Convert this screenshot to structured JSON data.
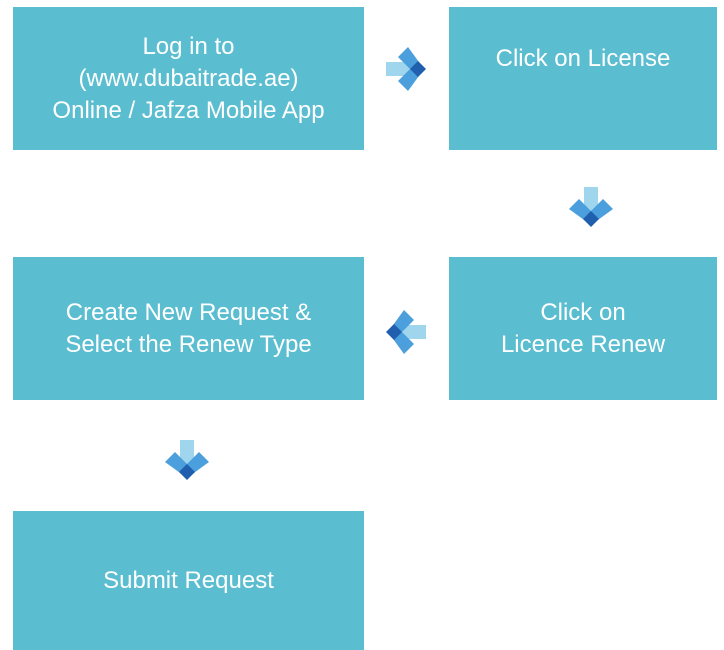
{
  "steps": [
    {
      "lines": [
        "Log in to",
        "(www.dubaitrade.ae)",
        "Online / Jafza Mobile App"
      ]
    },
    {
      "lines": [
        "Click on License"
      ]
    },
    {
      "lines": [
        "Click on",
        "Licence Renew"
      ]
    },
    {
      "lines": [
        "Create New Request &",
        "Select the Renew Type"
      ]
    },
    {
      "lines": [
        "Submit Request"
      ]
    }
  ],
  "arrows": [
    {
      "direction": "right",
      "icon": "chevron-arrow-right-icon"
    },
    {
      "direction": "down",
      "icon": "chevron-arrow-down-icon"
    },
    {
      "direction": "left",
      "icon": "chevron-arrow-left-icon"
    },
    {
      "direction": "down",
      "icon": "chevron-arrow-down-icon"
    }
  ],
  "colors": {
    "box": "#5bbdd0",
    "box_text": "#ffffff",
    "arrow_light": "#9fd6ee",
    "arrow_mid": "#4a9fdc",
    "arrow_dark": "#1f5fae"
  }
}
